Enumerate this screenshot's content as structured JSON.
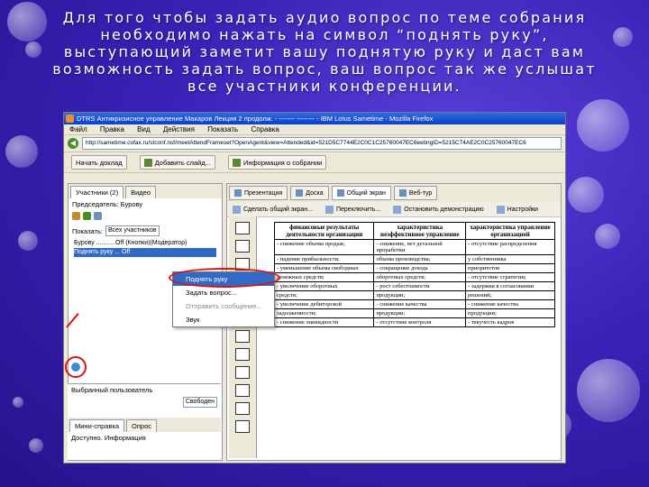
{
  "caption": "Для того чтобы задать аудио вопрос по теме собрания необходимо нажать на символ “поднять руку”, выступающий заметит вашу поднятую руку и даст вам возможность задать вопрос, ваш вопрос так же услышат все участники конференции.",
  "window": {
    "title": "DTRS Антикризисное управление Макаров Лекция 2 продолж. - ------- -------- - IBM Lotus Sametime - Mozilla Firefox",
    "menu": [
      "Файл",
      "Правка",
      "Вид",
      "Действия",
      "Показать",
      "Справка"
    ],
    "url": "http://sametime.cofax.ru/stconf.nsf/meetAttendFrameset?OpenAgent&view=Attended&id=521D5C7744E2C0C1C25760047EC6eetingID=5215C74AE2C0C25760047EC6"
  },
  "toolbar": {
    "leave_label": "Начать доклад",
    "add_label": "Добавить слайд...",
    "info_label": "Информация о собрании"
  },
  "left_panel": {
    "tabs": [
      "Участники (2)",
      "Видео"
    ],
    "presenter_label": "Председатель: Бурову",
    "show_label": "Показать:",
    "show_value": "Всех участников",
    "tree": [
      "Бурову ...........Off (Кнопки)(Модератор)",
      "Поднять руку ... Off"
    ],
    "bottom_label": "Выбранный пользователь",
    "status_value": "Свободен",
    "bottom_tabs": [
      "Мини-справка",
      "Опрос"
    ],
    "bottom_text": "Доступно. Информация"
  },
  "context_menu": {
    "items": [
      "Поднять руку",
      "Задать вопрос...",
      "Отправить сообщение...",
      "Звук"
    ]
  },
  "right_panel": {
    "tabs": [
      "Презентация",
      "Доска",
      "Общий экран",
      "Веб-тур"
    ],
    "tools": [
      "Сделать общий экран...",
      "Переключить...",
      "Остановить демонстрацию",
      "Настройки"
    ]
  },
  "document": {
    "headers": [
      "финансовые результаты деятельности организации",
      "характеристика неэффективное управление",
      "характеристика управление организацией"
    ],
    "rows": [
      [
        "- снижение объема продаж;",
        "- снижение, нет детальной проработки",
        "- отсутствие распределения"
      ],
      [
        "- падение прибыльности;",
        "объема производства;",
        "у собственника"
      ],
      [
        "- уменьшение объема свободных",
        "- сокращение дохода",
        "приоритетов"
      ],
      [
        "денежных средств;",
        "оборотных средств;",
        "- отсутствие стратегии;"
      ],
      [
        "- увеличение оборотных",
        "- рост себестоимости",
        "- задержки в согласовании"
      ],
      [
        "средств;",
        "продукции;",
        "решений;"
      ],
      [
        "- увеличение дебиторской",
        "- снижение качества",
        "- снижение качества"
      ],
      [
        "задолженности;",
        "продукции;",
        "продукции;"
      ],
      [
        "- снижение ликвидности",
        "- отсутствие контроля",
        "- текучесть кадров"
      ]
    ]
  }
}
